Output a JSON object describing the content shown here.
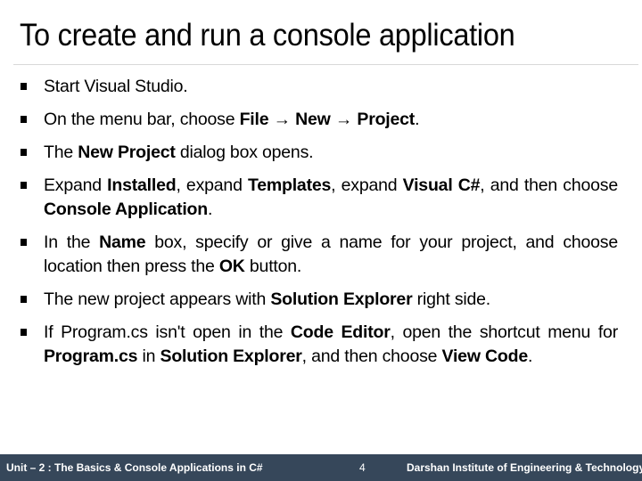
{
  "slide": {
    "title": "To create and run a console application",
    "bullets": [
      [
        {
          "t": "Start Visual Studio.",
          "b": false
        }
      ],
      [
        {
          "t": "On the menu bar, choose ",
          "b": false
        },
        {
          "t": "File",
          "b": true
        },
        {
          "t": " → ",
          "b": false
        },
        {
          "t": "New",
          "b": true
        },
        {
          "t": " → ",
          "b": false
        },
        {
          "t": "Project",
          "b": true
        },
        {
          "t": ".",
          "b": false
        }
      ],
      [
        {
          "t": "The ",
          "b": false
        },
        {
          "t": "New Project",
          "b": true
        },
        {
          "t": " dialog box opens.",
          "b": false
        }
      ],
      [
        {
          "t": "Expand ",
          "b": false
        },
        {
          "t": "Installed",
          "b": true
        },
        {
          "t": ", expand ",
          "b": false
        },
        {
          "t": "Templates",
          "b": true
        },
        {
          "t": ", expand ",
          "b": false
        },
        {
          "t": "Visual C#",
          "b": true
        },
        {
          "t": ", and then choose ",
          "b": false
        },
        {
          "t": "Console Application",
          "b": true
        },
        {
          "t": ".",
          "b": false
        }
      ],
      [
        {
          "t": "In the ",
          "b": false
        },
        {
          "t": "Name",
          "b": true
        },
        {
          "t": " box, specify or give a name for your project, and choose location then press the ",
          "b": false
        },
        {
          "t": "OK",
          "b": true
        },
        {
          "t": " button.",
          "b": false
        }
      ],
      [
        {
          "t": "The new project appears with ",
          "b": false
        },
        {
          "t": "Solution Explorer",
          "b": true
        },
        {
          "t": " right side.",
          "b": false
        }
      ],
      [
        {
          "t": "If Program.cs isn't open in the ",
          "b": false
        },
        {
          "t": "Code Editor",
          "b": true
        },
        {
          "t": ", open the shortcut menu for ",
          "b": false
        },
        {
          "t": "Program.cs",
          "b": true
        },
        {
          "t": " in ",
          "b": false
        },
        {
          "t": "Solution Explorer",
          "b": true
        },
        {
          "t": ", and then choose ",
          "b": false
        },
        {
          "t": "View Code",
          "b": true
        },
        {
          "t": ".",
          "b": false
        }
      ]
    ]
  },
  "footer": {
    "unit": "Unit – 2 : The Basics & Console Applications in C#",
    "page_number": "4",
    "institute": "Darshan Institute of Engineering & Technology",
    "background_color": "#36475a"
  }
}
